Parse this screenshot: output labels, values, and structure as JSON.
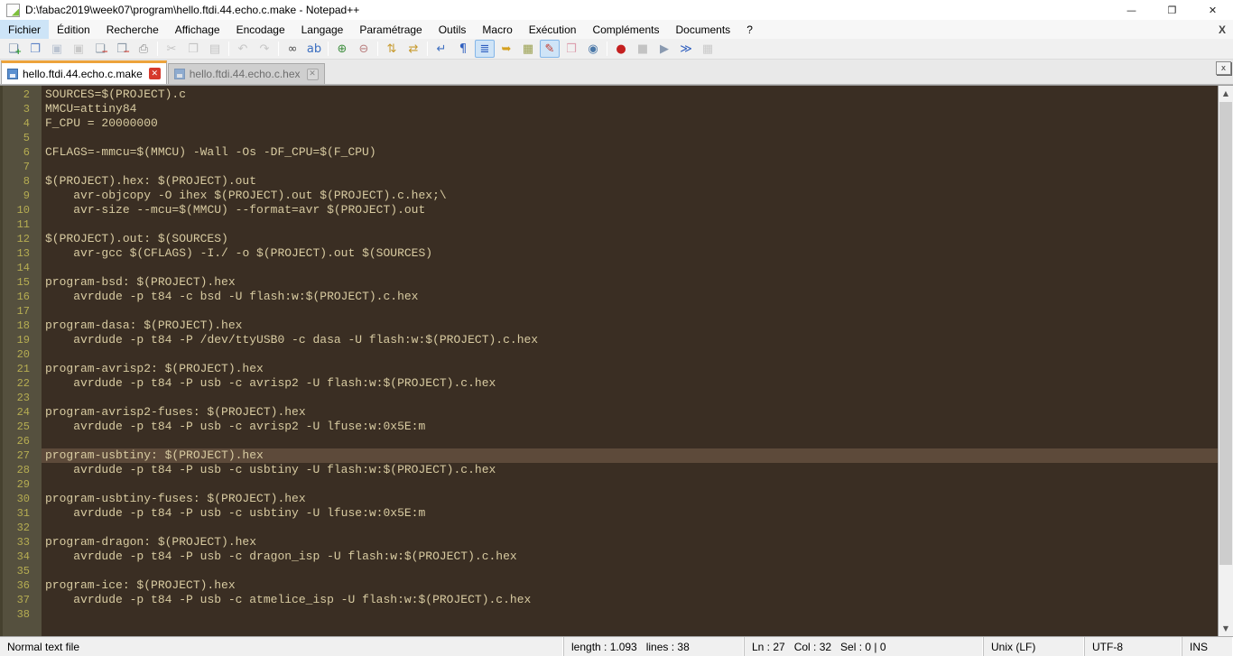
{
  "window": {
    "title": "D:\\fabac2019\\week07\\program\\hello.ftdi.44.echo.c.make - Notepad++",
    "minimize_glyph": "—",
    "restore_glyph": "❐",
    "close_glyph": "✕"
  },
  "menu": {
    "items": [
      "Fichier",
      "Édition",
      "Recherche",
      "Affichage",
      "Encodage",
      "Langage",
      "Paramétrage",
      "Outils",
      "Macro",
      "Exécution",
      "Compléments",
      "Documents",
      "?"
    ],
    "active_item": "Fichier",
    "close_label": "X"
  },
  "toolbar": {
    "buttons": [
      {
        "name": "new-file",
        "icon": "page-plus-icon",
        "glyph": "❏",
        "color": "#6f87a6",
        "badge": "+",
        "badge_color": "#2e9e2e",
        "state": "normal",
        "group_end": false
      },
      {
        "name": "open-file",
        "icon": "folder-open-icon",
        "glyph": "❐",
        "color": "#5b82c6",
        "state": "normal",
        "group_end": false
      },
      {
        "name": "save-file",
        "icon": "floppy-icon",
        "glyph": "▣",
        "color": "#8ea0b6",
        "state": "disabled",
        "group_end": false
      },
      {
        "name": "save-all",
        "icon": "floppy-stack-icon",
        "glyph": "▣",
        "color": "#a9a9a9",
        "state": "disabled",
        "group_end": false
      },
      {
        "name": "close-file",
        "icon": "page-close-icon",
        "glyph": "❏",
        "color": "#8d9aa8",
        "badge": "−",
        "badge_color": "#d23b2e",
        "state": "normal",
        "group_end": false
      },
      {
        "name": "close-all",
        "icon": "pages-close-icon",
        "glyph": "❐",
        "color": "#8d9aa8",
        "badge": "−",
        "badge_color": "#d23b2e",
        "state": "normal",
        "group_end": false
      },
      {
        "name": "print",
        "icon": "printer-icon",
        "glyph": "⎙",
        "color": "#8a8a8a",
        "state": "normal",
        "group_end": true
      },
      {
        "name": "cut",
        "icon": "scissors-icon",
        "glyph": "✂",
        "color": "#9f9f9f",
        "state": "disabled",
        "group_end": false
      },
      {
        "name": "copy",
        "icon": "copy-pages-icon",
        "glyph": "❐",
        "color": "#9f9f9f",
        "state": "disabled",
        "group_end": false
      },
      {
        "name": "paste",
        "icon": "clipboard-icon",
        "glyph": "▤",
        "color": "#9f9f9f",
        "state": "disabled",
        "group_end": true
      },
      {
        "name": "undo",
        "icon": "undo-arrow-icon",
        "glyph": "↶",
        "color": "#a5a5a5",
        "state": "disabled",
        "group_end": false
      },
      {
        "name": "redo",
        "icon": "redo-arrow-icon",
        "glyph": "↷",
        "color": "#a5a5a5",
        "state": "disabled",
        "group_end": true
      },
      {
        "name": "find",
        "icon": "binoculars-icon",
        "glyph": "∞",
        "color": "#4b4b4b",
        "state": "normal",
        "group_end": false
      },
      {
        "name": "replace",
        "icon": "replace-ab-icon",
        "glyph": "ab",
        "color": "#3a6ec0",
        "state": "normal",
        "group_end": true
      },
      {
        "name": "zoom-in",
        "icon": "magnifier-plus-icon",
        "glyph": "⊕",
        "color": "#3f8f3f",
        "state": "normal",
        "group_end": false
      },
      {
        "name": "zoom-out",
        "icon": "magnifier-minus-icon",
        "glyph": "⊖",
        "color": "#b97f7f",
        "state": "normal",
        "group_end": true
      },
      {
        "name": "sync-vertical-scroll",
        "icon": "lock-vertical-icon",
        "glyph": "⇅",
        "color": "#c79a2e",
        "state": "normal",
        "group_end": false
      },
      {
        "name": "sync-horizontal-scroll",
        "icon": "lock-horizontal-icon",
        "glyph": "⇄",
        "color": "#c79a2e",
        "state": "normal",
        "group_end": true
      },
      {
        "name": "word-wrap",
        "icon": "wrap-arrow-icon",
        "glyph": "↵",
        "color": "#3f6fc0",
        "state": "normal",
        "group_end": false
      },
      {
        "name": "show-all-characters",
        "icon": "pilcrow-icon",
        "glyph": "¶",
        "color": "#2f5fbf",
        "state": "normal",
        "group_end": false
      },
      {
        "name": "show-indent-guide",
        "icon": "indent-lines-icon",
        "glyph": "≣",
        "color": "#2f5fbf",
        "state": "active",
        "group_end": false
      },
      {
        "name": "function-list",
        "icon": "function-list-icon",
        "glyph": "➥",
        "color": "#d5a01f",
        "state": "normal",
        "group_end": false
      },
      {
        "name": "document-map",
        "icon": "doc-map-icon",
        "glyph": "▦",
        "color": "#9aa050",
        "state": "normal",
        "group_end": false
      },
      {
        "name": "document-list",
        "icon": "doc-pen-icon",
        "glyph": "✎",
        "color": "#c23a2e",
        "state": "active",
        "group_end": false
      },
      {
        "name": "folder-as-workspace",
        "icon": "folder-icon",
        "glyph": "❒",
        "color": "#dc9fae",
        "state": "normal",
        "group_end": false
      },
      {
        "name": "file-monitoring",
        "icon": "eye-icon",
        "glyph": "◉",
        "color": "#4a78a8",
        "state": "normal",
        "group_end": true
      },
      {
        "name": "macro-record",
        "icon": "record-dot-icon",
        "glyph": "●",
        "color": "#c41f1f",
        "state": "normal",
        "group_end": false
      },
      {
        "name": "macro-stop",
        "icon": "stop-square-icon",
        "glyph": "■",
        "color": "#9f9f9f",
        "state": "disabled",
        "group_end": false
      },
      {
        "name": "macro-play",
        "icon": "play-triangle-icon",
        "glyph": "▶",
        "color": "#8a9ab0",
        "state": "normal",
        "group_end": false
      },
      {
        "name": "macro-run-multiple",
        "icon": "fast-forward-icon",
        "glyph": "≫",
        "color": "#2f5fbf",
        "state": "normal",
        "group_end": false
      },
      {
        "name": "macro-save",
        "icon": "macro-save-icon",
        "glyph": "▦",
        "color": "#ababab",
        "state": "disabled",
        "group_end": false
      }
    ]
  },
  "tabs": {
    "close_glyph": "✕",
    "items": [
      {
        "label": "hello.ftdi.44.echo.c.make",
        "active": true
      },
      {
        "label": "hello.ftdi.44.echo.c.hex",
        "active": false
      }
    ],
    "tabbar_button_glyph": "x"
  },
  "editor": {
    "current_line": 27,
    "colors": {
      "background": "#3a2e23",
      "gutter_background": "#55503e",
      "line_number": "#b6ad52",
      "text": "#d8cba1",
      "current_line_background": "#5d4a3a",
      "active_tab_accent": "#eda33b"
    },
    "lines": [
      {
        "n": 2,
        "text": "SOURCES=$(PROJECT).c"
      },
      {
        "n": 3,
        "text": "MMCU=attiny84"
      },
      {
        "n": 4,
        "text": "F_CPU = 20000000"
      },
      {
        "n": 5,
        "text": ""
      },
      {
        "n": 6,
        "text": "CFLAGS=-mmcu=$(MMCU) -Wall -Os -DF_CPU=$(F_CPU)"
      },
      {
        "n": 7,
        "text": ""
      },
      {
        "n": 8,
        "text": "$(PROJECT).hex: $(PROJECT).out"
      },
      {
        "n": 9,
        "text": "\tavr-objcopy -O ihex $(PROJECT).out $(PROJECT).c.hex;\\"
      },
      {
        "n": 10,
        "text": "\tavr-size --mcu=$(MMCU) --format=avr $(PROJECT).out"
      },
      {
        "n": 11,
        "text": ""
      },
      {
        "n": 12,
        "text": "$(PROJECT).out: $(SOURCES)"
      },
      {
        "n": 13,
        "text": "\tavr-gcc $(CFLAGS) -I./ -o $(PROJECT).out $(SOURCES)"
      },
      {
        "n": 14,
        "text": ""
      },
      {
        "n": 15,
        "text": "program-bsd: $(PROJECT).hex"
      },
      {
        "n": 16,
        "text": "\tavrdude -p t84 -c bsd -U flash:w:$(PROJECT).c.hex"
      },
      {
        "n": 17,
        "text": ""
      },
      {
        "n": 18,
        "text": "program-dasa: $(PROJECT).hex"
      },
      {
        "n": 19,
        "text": "\tavrdude -p t84 -P /dev/ttyUSB0 -c dasa -U flash:w:$(PROJECT).c.hex"
      },
      {
        "n": 20,
        "text": ""
      },
      {
        "n": 21,
        "text": "program-avrisp2: $(PROJECT).hex"
      },
      {
        "n": 22,
        "text": "\tavrdude -p t84 -P usb -c avrisp2 -U flash:w:$(PROJECT).c.hex"
      },
      {
        "n": 23,
        "text": ""
      },
      {
        "n": 24,
        "text": "program-avrisp2-fuses: $(PROJECT).hex"
      },
      {
        "n": 25,
        "text": "\tavrdude -p t84 -P usb -c avrisp2 -U lfuse:w:0x5E:m"
      },
      {
        "n": 26,
        "text": ""
      },
      {
        "n": 27,
        "text": "program-usbtiny: $(PROJECT).hex"
      },
      {
        "n": 28,
        "text": "\tavrdude -p t84 -P usb -c usbtiny -U flash:w:$(PROJECT).c.hex"
      },
      {
        "n": 29,
        "text": ""
      },
      {
        "n": 30,
        "text": "program-usbtiny-fuses: $(PROJECT).hex"
      },
      {
        "n": 31,
        "text": "\tavrdude -p t84 -P usb -c usbtiny -U lfuse:w:0x5E:m"
      },
      {
        "n": 32,
        "text": ""
      },
      {
        "n": 33,
        "text": "program-dragon: $(PROJECT).hex"
      },
      {
        "n": 34,
        "text": "\tavrdude -p t84 -P usb -c dragon_isp -U flash:w:$(PROJECT).c.hex"
      },
      {
        "n": 35,
        "text": ""
      },
      {
        "n": 36,
        "text": "program-ice: $(PROJECT).hex"
      },
      {
        "n": 37,
        "text": "\tavrdude -p t84 -P usb -c atmelice_isp -U flash:w:$(PROJECT).c.hex"
      },
      {
        "n": 38,
        "text": ""
      }
    ]
  },
  "scrollbar": {
    "up_glyph": "▲",
    "down_glyph": "▼"
  },
  "status": {
    "doc_type": "Normal text file",
    "length_lines": "length : 1.093   lines : 38",
    "position": "Ln : 27   Col : 32   Sel : 0 | 0",
    "eol": "Unix (LF)",
    "encoding": "UTF-8",
    "insert_mode": "INS"
  }
}
